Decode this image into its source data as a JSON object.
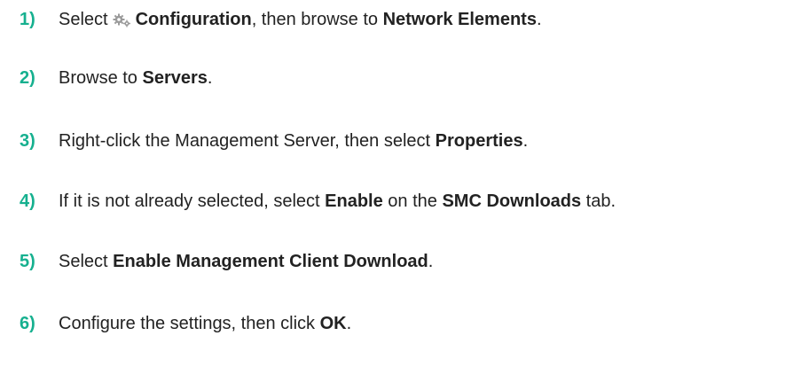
{
  "steps": [
    {
      "number": "1)",
      "t1": "Select",
      "icon": "configuration-gears-icon",
      "b1": "Configuration",
      "t2": ", then browse to ",
      "b2": "Network Elements",
      "t3": "."
    },
    {
      "number": "2)",
      "t1": "Browse to ",
      "b1": "Servers",
      "t2": "."
    },
    {
      "number": "3)",
      "t1": "Right-click the Management Server, then select ",
      "b1": "Properties",
      "t2": "."
    },
    {
      "number": "4)",
      "t1": "If it is not already selected, select ",
      "b1": "Enable",
      "t2": " on the ",
      "b2": "SMC Downloads",
      "t3": " tab."
    },
    {
      "number": "5)",
      "t1": "Select ",
      "b1": "Enable Management Client Download",
      "t2": "."
    },
    {
      "number": "6)",
      "t1": "Configure the settings, then click ",
      "b1": "OK",
      "t2": "."
    }
  ],
  "colors": {
    "step_number": "#16b08f",
    "text": "#222222",
    "icon": "#9a9a9a"
  }
}
